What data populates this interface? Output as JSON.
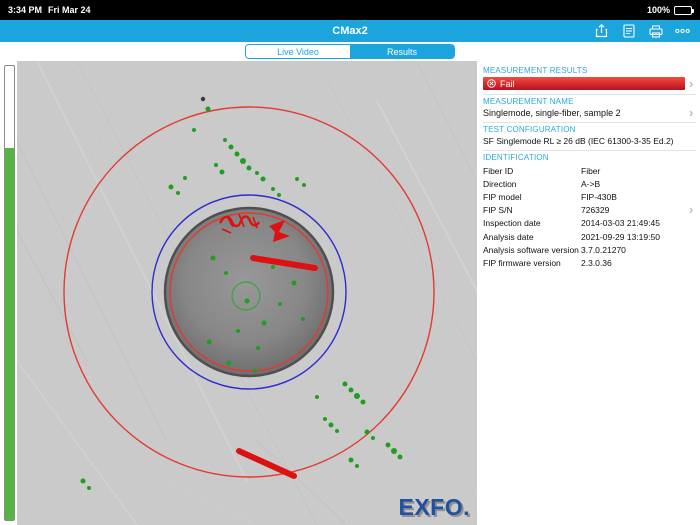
{
  "status_bar": {
    "time": "3:34 PM",
    "date": "Fri Mar 24",
    "battery_percent": "100%"
  },
  "header": {
    "title": "CMax2"
  },
  "tabs": {
    "live_video": "Live Video",
    "results": "Results"
  },
  "panel": {
    "measurement_results": {
      "header": "MEASUREMENT RESULTS",
      "status": "Fail"
    },
    "measurement_name": {
      "header": "MEASUREMENT NAME",
      "value": "Singlemode, single-fiber, sample 2"
    },
    "test_configuration": {
      "header": "TEST CONFIGURATION",
      "value": "SF Singlemode RL ≥ 26 dB  (IEC 61300-3-35 Ed.2)"
    },
    "identification": {
      "header": "IDENTIFICATION",
      "rows": [
        {
          "label": "Fiber ID",
          "value": "Fiber"
        },
        {
          "label": "Direction",
          "value": "A->B"
        },
        {
          "label": "FIP model",
          "value": "FIP-430B"
        },
        {
          "label": "FIP S/N",
          "value": "726329"
        },
        {
          "label": "Inspection date",
          "value": "2014-03-03 21:49:45"
        },
        {
          "label": "Analysis date",
          "value": "2021-09-29 13:19:50"
        },
        {
          "label": "Analysis software version",
          "value": "3.7.0.21270"
        },
        {
          "label": "FIP firmware version",
          "value": "2.3.0.36"
        }
      ]
    }
  },
  "image": {
    "logo": "EXFO."
  },
  "icons": {
    "chevron": "›"
  },
  "colors": {
    "accent": "#1ca5dc",
    "fail_red": "#c5101e",
    "pass_green": "#55b543"
  }
}
